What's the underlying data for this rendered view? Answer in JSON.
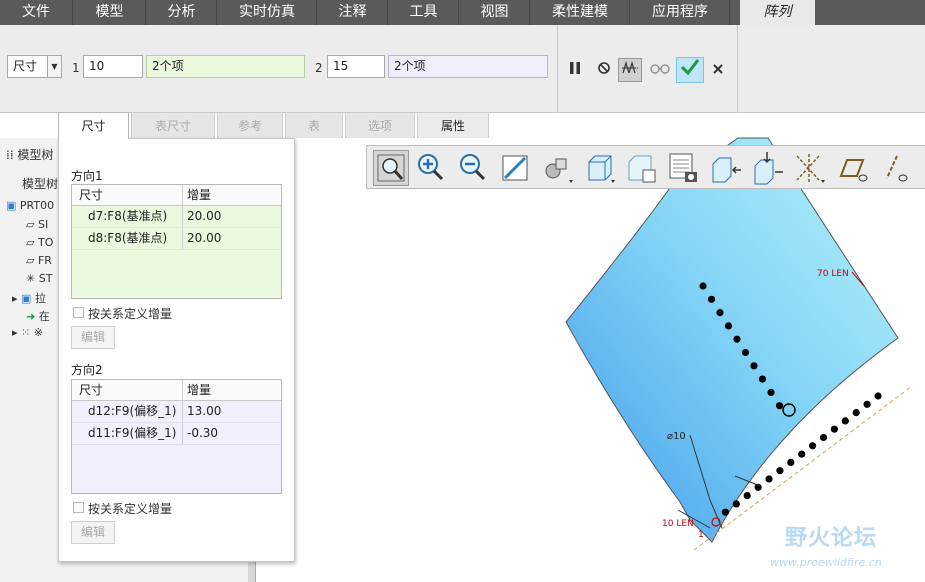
{
  "menubar": {
    "tabs": [
      "文件",
      "模型",
      "分析",
      "实时仿真",
      "注释",
      "工具",
      "视图",
      "柔性建模",
      "应用程序",
      "阵列"
    ],
    "active_tab": "阵列"
  },
  "dashboard": {
    "type_select": "尺寸",
    "dir1": {
      "index": "1",
      "count": "10",
      "items": "2个项"
    },
    "dir2": {
      "index": "2",
      "count": "15",
      "items": "2个项"
    },
    "controls": [
      "pause",
      "stop",
      "preview",
      "glasses",
      "confirm",
      "cancel"
    ]
  },
  "subtabs": [
    "尺寸",
    "表尺寸",
    "参考",
    "表",
    "选项",
    "属性"
  ],
  "dims_panel": {
    "direction1": {
      "label": "方向1",
      "headers": [
        "尺寸",
        "增量"
      ],
      "rows": [
        {
          "dim": "d7:F8(基准点)",
          "inc": "20.00"
        },
        {
          "dim": "d8:F8(基准点)",
          "inc": "20.00"
        }
      ],
      "relation_label": "按关系定义增量",
      "edit_label": "编辑"
    },
    "direction2": {
      "label": "方向2",
      "headers": [
        "尺寸",
        "增量"
      ],
      "rows": [
        {
          "dim": "d12:F9(偏移_1)",
          "inc": "13.00"
        },
        {
          "dim": "d11:F9(偏移_1)",
          "inc": "-0.30"
        }
      ],
      "relation_label": "按关系定义增量",
      "edit_label": "编辑"
    }
  },
  "model_tree": {
    "header_label": "模型树",
    "tab_label": "模型树",
    "items": [
      "PRT00",
      "SI",
      "TO",
      "FR",
      "ST",
      "拉",
      "在",
      "※"
    ]
  },
  "graphics": {
    "annotations": [
      "70 LEN",
      "⌀10",
      "10 LEN",
      "1"
    ],
    "watermark": "野火论坛",
    "watermark_url": "www.proewildfire.cn"
  },
  "colors": {
    "menubar_bg": "#5a5a5a",
    "ribbon_bg": "#ececec",
    "part_light": "#a8eef8",
    "part_dark": "#4ca4ec",
    "confirm": "#1a9a3a"
  }
}
